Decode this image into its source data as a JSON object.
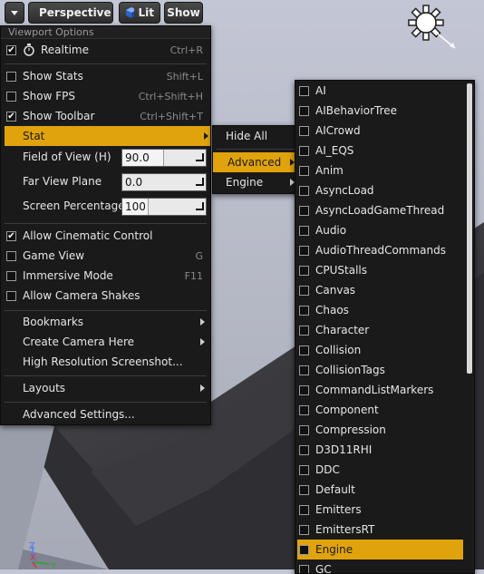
{
  "toolbar": {
    "perspective_label": "Perspective",
    "lit_label": "Lit",
    "show_label": "Show"
  },
  "viewport_menu": {
    "header": "Viewport Options",
    "realtime": {
      "label": "Realtime",
      "shortcut": "Ctrl+R",
      "checked": true
    },
    "show_stats": {
      "label": "Show Stats",
      "shortcut": "Shift+L",
      "checked": false
    },
    "show_fps": {
      "label": "Show FPS",
      "shortcut": "Ctrl+Shift+H",
      "checked": false
    },
    "show_toolbar": {
      "label": "Show Toolbar",
      "shortcut": "Ctrl+Shift+T",
      "checked": true
    },
    "stat": {
      "label": "Stat"
    },
    "fov": {
      "label": "Field of View (H)",
      "value": "90.0",
      "fill_fraction": 0.5
    },
    "far_view_plane": {
      "label": "Far View Plane",
      "value": "0.0",
      "fill_fraction": 0
    },
    "screen_percentage": {
      "label": "Screen Percentage",
      "value": "100",
      "fill_fraction": 0.32
    },
    "allow_cinematic": {
      "label": "Allow Cinematic Control",
      "checked": true
    },
    "game_view": {
      "label": "Game View",
      "shortcut": "G",
      "checked": false
    },
    "immersive": {
      "label": "Immersive Mode",
      "shortcut": "F11",
      "checked": false
    },
    "camera_shakes": {
      "label": "Allow Camera Shakes",
      "checked": false
    },
    "bookmarks": {
      "label": "Bookmarks"
    },
    "create_camera": {
      "label": "Create Camera Here"
    },
    "hires_screenshot": {
      "label": "High Resolution Screenshot..."
    },
    "layouts": {
      "label": "Layouts"
    },
    "advanced_settings": {
      "label": "Advanced Settings..."
    }
  },
  "stat_menu": {
    "hide_all": "Hide All",
    "advanced": "Advanced",
    "engine": "Engine"
  },
  "advanced_menu": {
    "items": [
      "AI",
      "AIBehaviorTree",
      "AICrowd",
      "AI_EQS",
      "Anim",
      "AsyncLoad",
      "AsyncLoadGameThread",
      "Audio",
      "AudioThreadCommands",
      "CPUStalls",
      "Canvas",
      "Chaos",
      "Character",
      "Collision",
      "CollisionTags",
      "CommandListMarkers",
      "Component",
      "Compression",
      "D3D11RHI",
      "DDC",
      "Default",
      "Emitters",
      "EmittersRT",
      "Engine",
      "GC"
    ],
    "highlighted": "Engine"
  },
  "axis": {
    "z": "Z",
    "x": "X",
    "y": "Y"
  },
  "colors": {
    "highlight": "#e0a30c",
    "menu_bg": "#1a1a1a"
  }
}
